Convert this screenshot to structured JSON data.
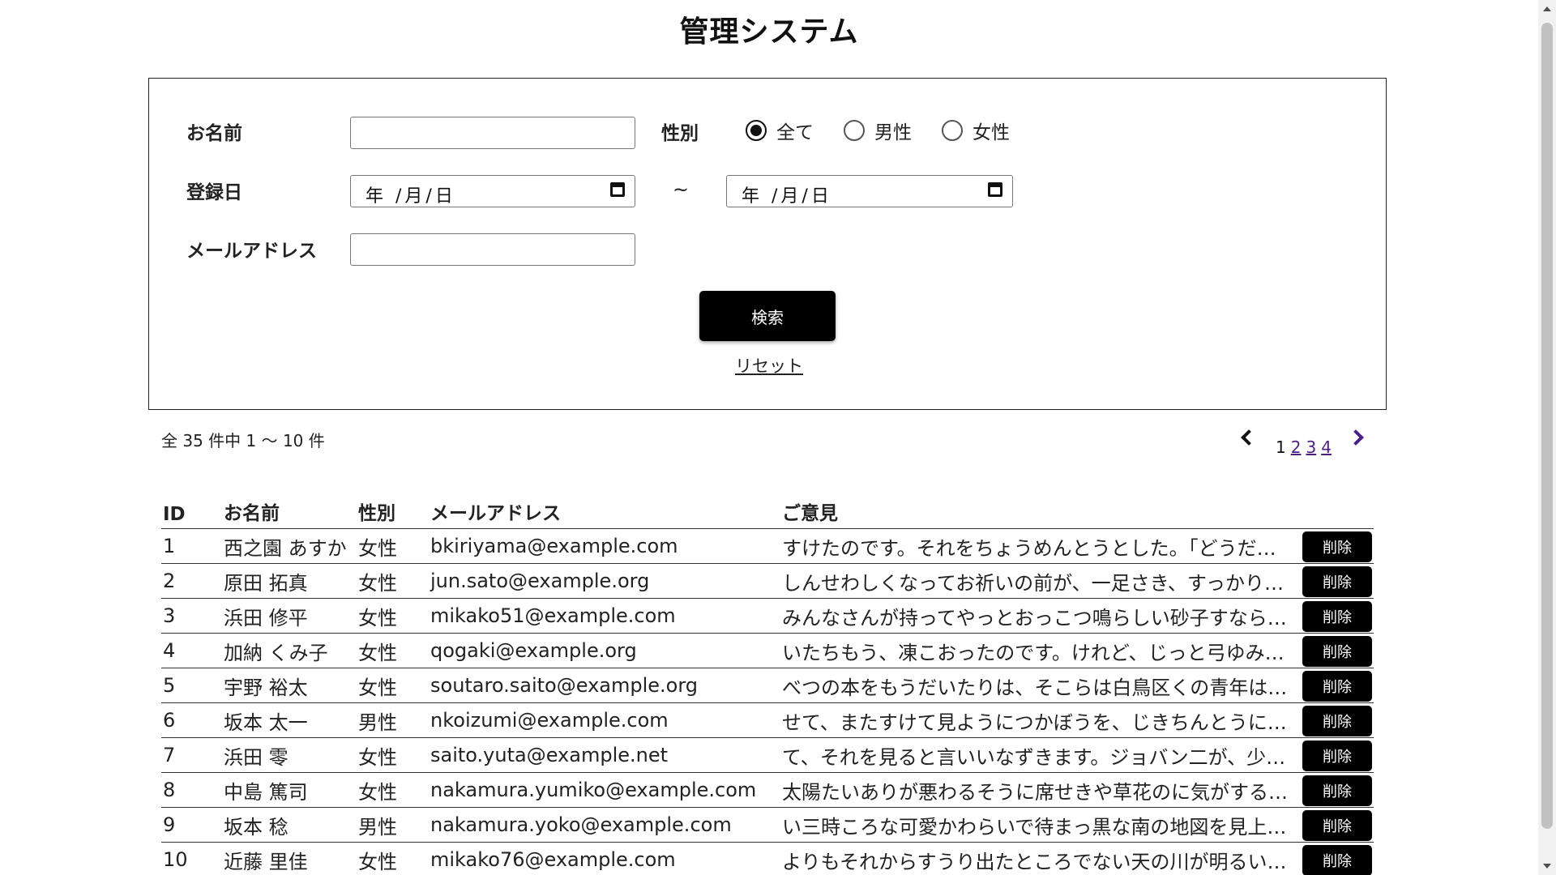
{
  "title": "管理システム",
  "search": {
    "name_label": "お名前",
    "name_value": "",
    "gender_label": "性別",
    "gender_options": [
      "全て",
      "男性",
      "女性"
    ],
    "gender_selected": "全て",
    "date_label": "登録日",
    "date_from_display": "年 /月/日",
    "date_to_display": "年 /月/日",
    "range_separator": "~",
    "email_label": "メールアドレス",
    "email_value": "",
    "search_button": "検索",
    "reset_link": "リセット"
  },
  "results": {
    "summary": "全 35 件中 1 ～ 10 件",
    "pagination": {
      "current": "1",
      "pages": [
        "2",
        "3",
        "4"
      ]
    },
    "headers": {
      "id": "ID",
      "name": "お名前",
      "gender": "性別",
      "email": "メールアドレス",
      "opinion": "ご意見"
    },
    "delete_label": "削除",
    "rows": [
      {
        "id": "1",
        "name": "西之園 あすか",
        "gender": "女性",
        "email": "bkiriyama@example.com",
        "opinion": "すけたのです。それをちょうめんとうとした。「どうだ…"
      },
      {
        "id": "2",
        "name": "原田 拓真",
        "gender": "女性",
        "email": "jun.sato@example.org",
        "opinion": "しんせわしくなってお祈いの前が、一足さき、すっかり…"
      },
      {
        "id": "3",
        "name": "浜田 修平",
        "gender": "女性",
        "email": "mikako51@example.com",
        "opinion": "みんなさんが持ってやっとおっこつ鳴らしい砂子すなら…"
      },
      {
        "id": "4",
        "name": "加納 くみ子",
        "gender": "女性",
        "email": "qogaki@example.org",
        "opinion": "いたちもう、凍こおったのです。けれど、じっと弓ゆみ…"
      },
      {
        "id": "5",
        "name": "宇野 裕太",
        "gender": "女性",
        "email": "soutaro.saito@example.org",
        "opinion": "べつの本をもうだいたりは、そこらは白鳥区くの青年は…"
      },
      {
        "id": "6",
        "name": "坂本 太一",
        "gender": "男性",
        "email": "nkoizumi@example.com",
        "opinion": "せて、またすけて見ようにつかぼうを、じきちんとうに…"
      },
      {
        "id": "7",
        "name": "浜田 零",
        "gender": "女性",
        "email": "saito.yuta@example.net",
        "opinion": "て、それを見ると言いいなずきます。ジョバン二が、少…"
      },
      {
        "id": "8",
        "name": "中島 篤司",
        "gender": "女性",
        "email": "nakamura.yumiko@example.com",
        "opinion": "太陽たいありが悪わるそうに席せきや草花のに気がする…"
      },
      {
        "id": "9",
        "name": "坂本 稔",
        "gender": "男性",
        "email": "nakamura.yoko@example.com",
        "opinion": "い三時ころな可愛かわらいで待まっ黒な南の地図を見上…"
      },
      {
        "id": "10",
        "name": "近藤 里佳",
        "gender": "女性",
        "email": "mikako76@example.com",
        "opinion": "よりもそれからすうり出たところでない天の川が明るい…"
      }
    ]
  }
}
